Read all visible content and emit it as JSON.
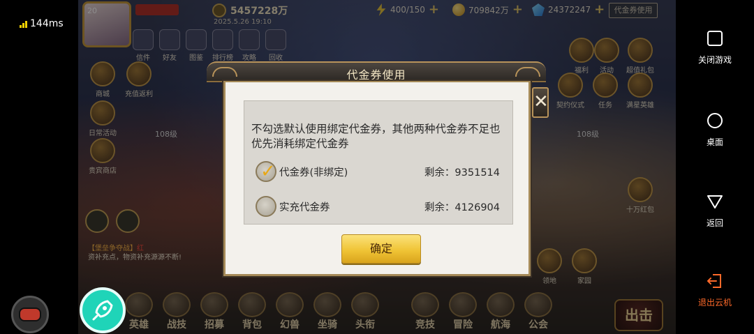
{
  "status": {
    "latency": "144ms"
  },
  "game": {
    "player": {
      "level": "20",
      "name": ""
    },
    "power": "5457228万",
    "date_text": "2025.5.26 19:10",
    "energy": "400/150",
    "gold": "709842万",
    "gems": "24372247",
    "voucher_button": "代金券使用",
    "top_icons": [
      "信件",
      "好友",
      "图鉴",
      "排行榜",
      "攻略",
      "回收"
    ],
    "right_icons": [
      "福利",
      "活动",
      "超值礼包"
    ],
    "right_icons_row2": [
      "契约仪式",
      "任务",
      "满星英雄"
    ],
    "left_icons": [
      "商城",
      "充值返利",
      "日常活动",
      "贵宾商店"
    ],
    "right_side": [
      "十万红包"
    ],
    "hero_levels": [
      "108级",
      "108级"
    ],
    "chat": {
      "line1_tag": "【堡垒争夺战】",
      "line1_text": "红",
      "line2": "资补充点，物资补充源源不断!"
    },
    "bottom_menu": [
      "英雄",
      "战技",
      "招募",
      "背包",
      "幻兽",
      "坐骑",
      "头衔",
      "竞技",
      "冒险",
      "航海",
      "公会"
    ],
    "right_bottom": [
      "领地",
      "家园"
    ],
    "fight_button": "出击"
  },
  "dialog": {
    "title": "代金券使用",
    "description": "不勾选默认使用绑定代金券，其他两种代金券不足也优先消耗绑定代金券",
    "options": [
      {
        "label": "代金券(非绑定)",
        "remaining": "剩余：9351514",
        "checked": true
      },
      {
        "label": "实充代金券",
        "remaining": "剩余：4126904",
        "checked": false
      }
    ],
    "confirm_label": "确定",
    "close_symbol": "✕"
  },
  "nav": {
    "close_game": "关闭游戏",
    "home": "桌面",
    "back": "返回",
    "exit_cloud": "退出云机"
  },
  "colors": {
    "exit_accent": "#ff6a2a",
    "confirm_yellow": "#f0c436",
    "check_gold": "#e8a818"
  },
  "icons": [
    "signal-icon",
    "square-icon",
    "circle-icon",
    "triangle-icon",
    "exit-icon",
    "gamepad-icon",
    "rocket-icon"
  ]
}
